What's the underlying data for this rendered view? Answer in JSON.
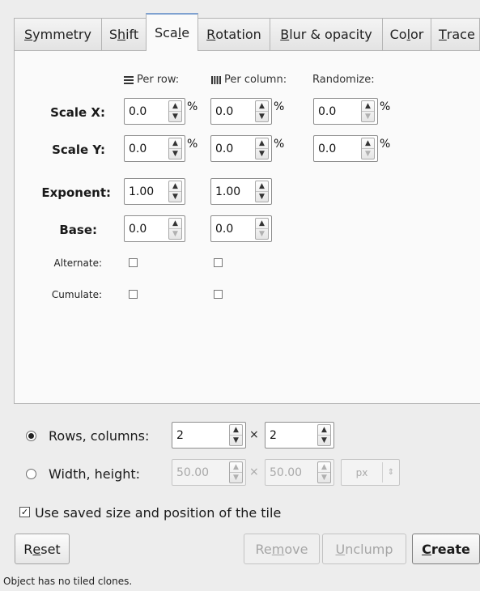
{
  "tabs": [
    {
      "pre": "",
      "u": "S",
      "post": "ymmetry"
    },
    {
      "pre": "S",
      "u": "h",
      "post": "ift"
    },
    {
      "pre": "Sca",
      "u": "l",
      "post": "e"
    },
    {
      "pre": "",
      "u": "R",
      "post": "otation"
    },
    {
      "pre": "",
      "u": "B",
      "post": "lur & opacity"
    },
    {
      "pre": "Co",
      "u": "l",
      "post": "or"
    },
    {
      "pre": "",
      "u": "T",
      "post": "race"
    }
  ],
  "active_tab": "Scale",
  "headers": {
    "per_row": "Per row:",
    "per_column": "Per column:",
    "randomize": "Randomize:"
  },
  "rows": {
    "scale_x": {
      "label": "Scale X:",
      "row_val": "0.0",
      "col_val": "0.0",
      "rand_val": "0.0",
      "unit": "%"
    },
    "scale_y": {
      "label": "Scale Y:",
      "row_val": "0.0",
      "col_val": "0.0",
      "rand_val": "0.0",
      "unit": "%"
    },
    "exponent": {
      "label": "Exponent:",
      "row_val": "1.00",
      "col_val": "1.00"
    },
    "base": {
      "label": "Base:",
      "row_val": "0.0",
      "col_val": "0.0"
    },
    "alternate": {
      "label": "Alternate:",
      "row_checked": false,
      "col_checked": false
    },
    "cumulate": {
      "label": "Cumulate:",
      "row_checked": false,
      "col_checked": false
    }
  },
  "tiling": {
    "rows_columns_label": "Rows, columns:",
    "rows": "2",
    "columns": "2",
    "width_height_label": "Width, height:",
    "width": "50.00",
    "height": "50.00",
    "unit": "px",
    "times": "×",
    "selected": "rows_columns"
  },
  "use_saved": {
    "label": "Use saved size and position of the tile",
    "checked": true
  },
  "buttons": {
    "reset": {
      "pre": "R",
      "u": "e",
      "post": "set"
    },
    "remove": {
      "pre": "Re",
      "u": "m",
      "post": "ove"
    },
    "unclump": {
      "pre": "",
      "u": "U",
      "post": "nclump"
    },
    "create": {
      "pre": "",
      "u": "C",
      "post": "reate"
    }
  },
  "status": "Object has no tiled clones.",
  "glyphs": {
    "up": "▲",
    "down": "▼",
    "check": "✓",
    "updown": "⇕"
  },
  "colors": {
    "active_tab_accent": "#7fa1d0",
    "panel_bg": "#fafafa",
    "window_bg": "#ededed"
  }
}
